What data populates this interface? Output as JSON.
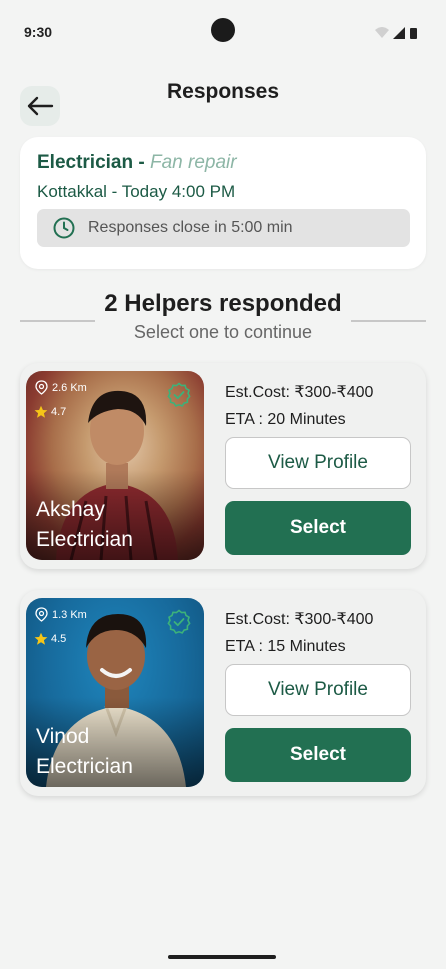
{
  "status_bar": {
    "time": "9:30",
    "icons": [
      "wifi-icon",
      "signal-icon",
      "battery-icon"
    ]
  },
  "header": {
    "title": "Responses",
    "back_icon": "arrow-left-icon"
  },
  "job": {
    "service": "Electrician",
    "separator": " - ",
    "issue": "Fan repair",
    "location_time": "Kottakkal - Today 4:00 PM",
    "timer_text": "Responses close in 5:00 min"
  },
  "responses": {
    "title": "2 Helpers responded",
    "subtitle": "Select one to continue"
  },
  "helpers": [
    {
      "name": "Akshay",
      "trade": "Electrician",
      "distance": "2.6 Km",
      "rating": "4.7",
      "cost": "Est.Cost: ₹300-₹400",
      "eta": "ETA : 20 Minutes",
      "view_label": "View Profile",
      "select_label": "Select"
    },
    {
      "name": "Vinod",
      "trade": "Electrician",
      "distance": "1.3 Km",
      "rating": "4.5",
      "cost": "Est.Cost: ₹300-₹400",
      "eta": "ETA : 15 Minutes",
      "view_label": "View Profile",
      "select_label": "Select"
    }
  ],
  "colors": {
    "primary": "#227052",
    "accent_text": "#1c5a45",
    "muted_green": "#8db6a6",
    "background": "#f3f4f3",
    "star": "#f5c518"
  }
}
